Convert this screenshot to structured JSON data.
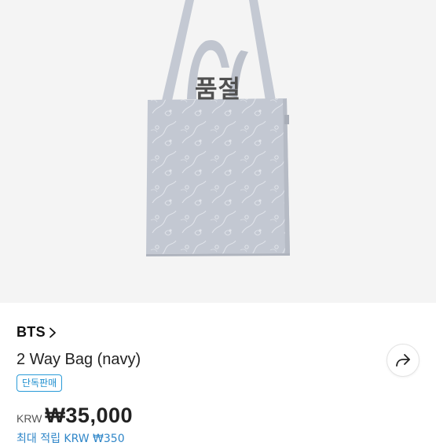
{
  "product_image": {
    "overlay_status": "품절",
    "icon": "tote-bag-image"
  },
  "product": {
    "brand": "BTS",
    "brand_chevron_icon": "chevron-right-icon",
    "name": "2 Way Bag (navy)",
    "badge": "단독판매",
    "currency_label": "KRW",
    "price": "₩35,000",
    "points_text": "최대 적립 KRW ₩350"
  },
  "actions": {
    "share_icon": "share-icon"
  },
  "colors": {
    "hero_background": "#f4f4f4",
    "bag_fill": "#c3c8d2",
    "badge_accent": "#2a9bd8",
    "link_blue": "#2f86c8"
  }
}
